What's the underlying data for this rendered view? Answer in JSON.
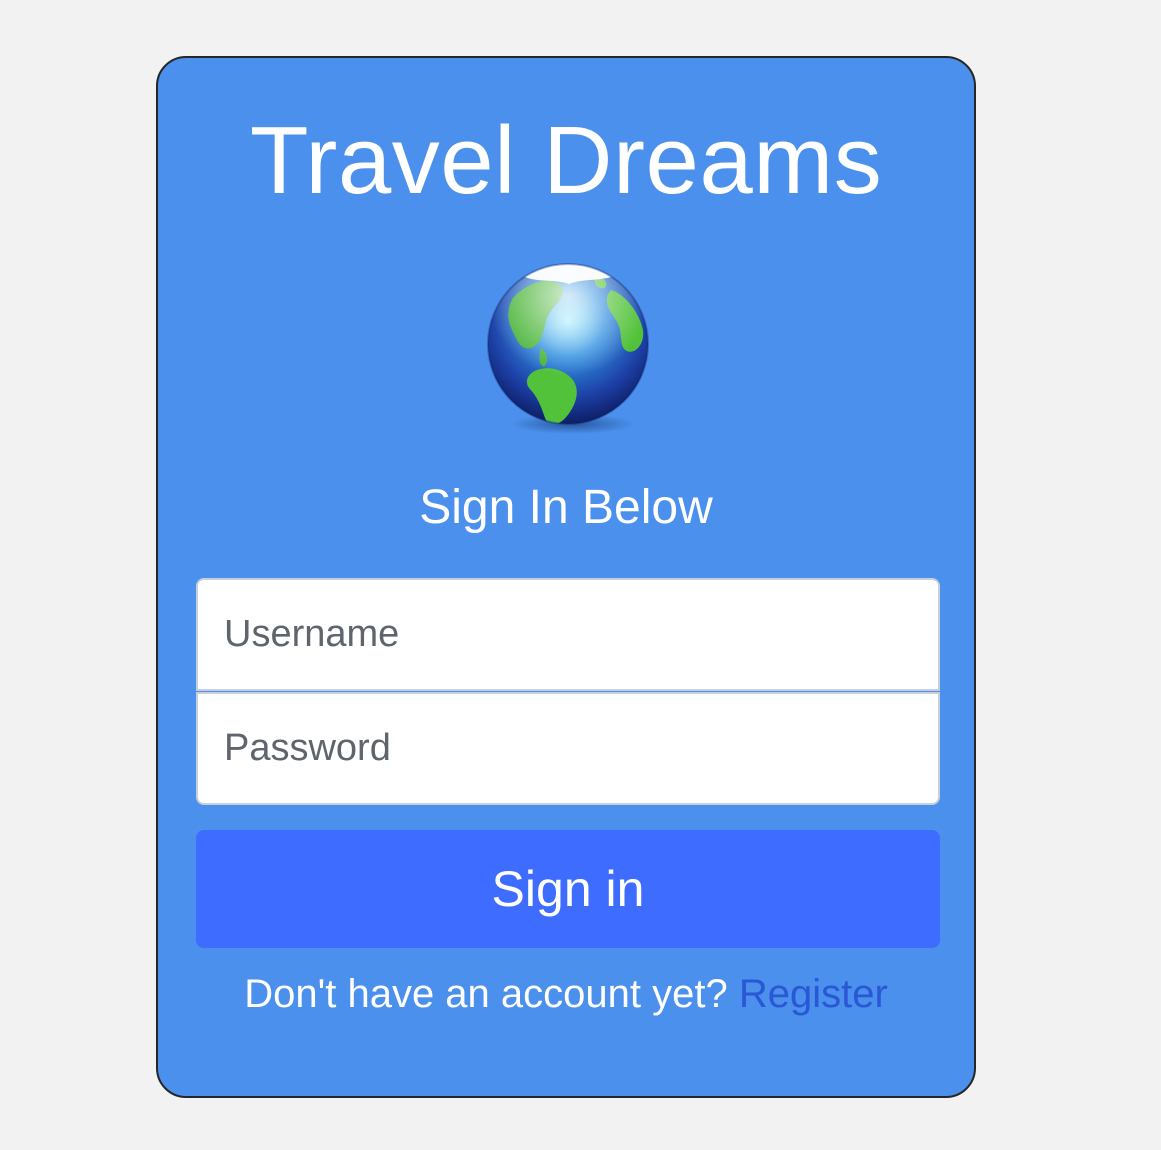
{
  "app": {
    "title": "Travel Dreams"
  },
  "logo": {
    "icon": "globe-icon"
  },
  "form": {
    "heading": "Sign In Below",
    "username": {
      "placeholder": "Username",
      "value": ""
    },
    "password": {
      "placeholder": "Password",
      "value": ""
    },
    "submit_label": "Sign in"
  },
  "footer": {
    "prompt": "Don't have an account yet?",
    "register_label": "Register"
  },
  "colors": {
    "page_background": "#f2f2f2",
    "card_background": "#4a90ec",
    "button_background": "#3d6cfe",
    "link": "#2a57d6"
  }
}
